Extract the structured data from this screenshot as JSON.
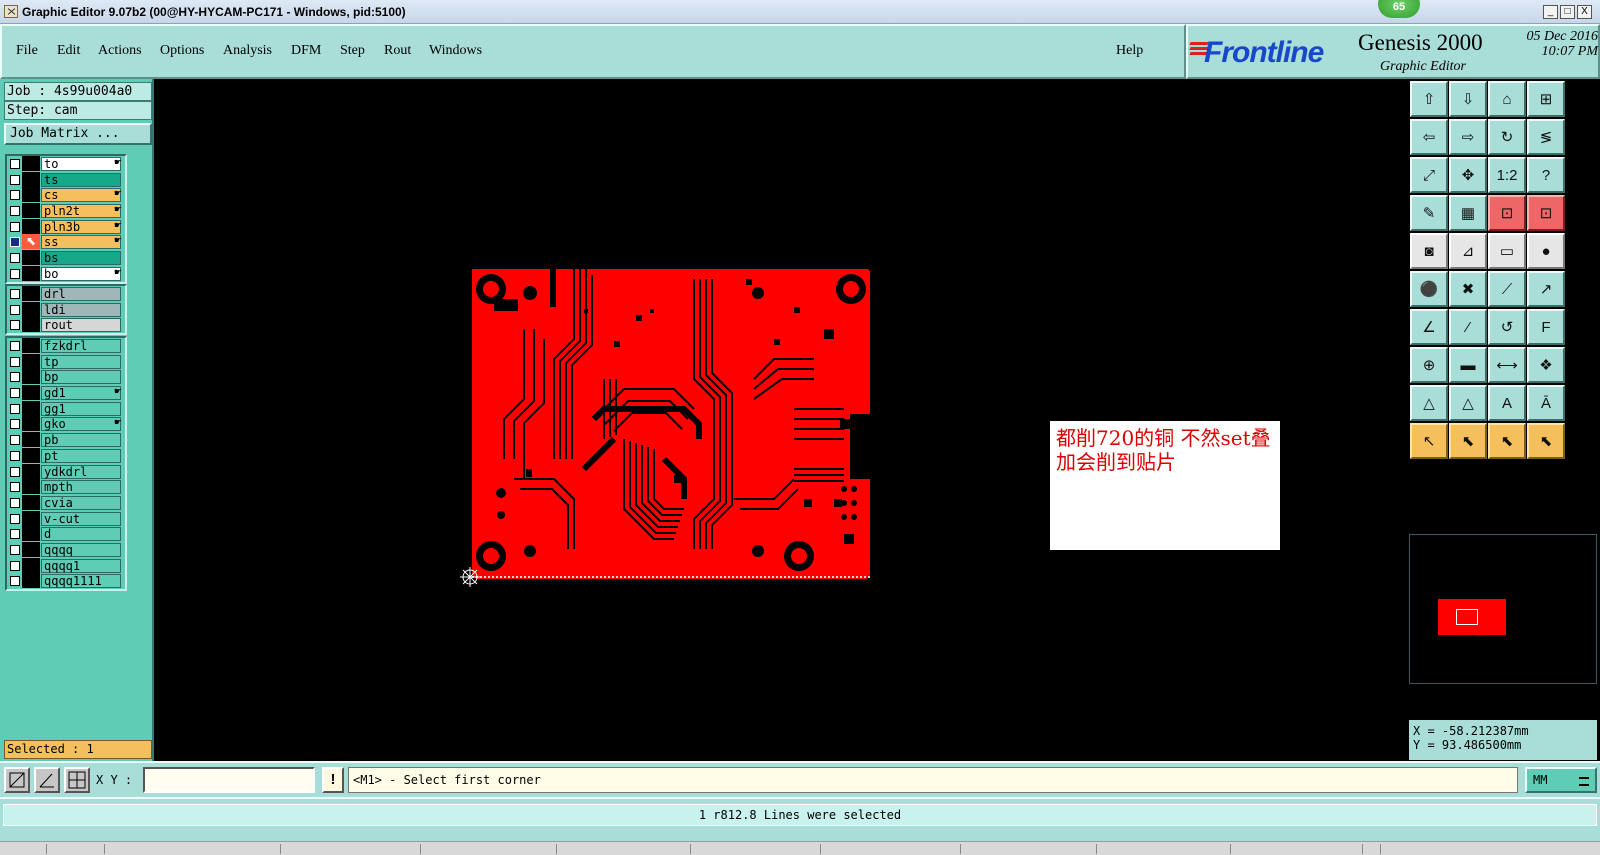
{
  "window": {
    "title": "Graphic Editor 9.07b2 (00@HY-HYCAM-PC171 - Windows, pid:5100)",
    "badge": "65",
    "controls": [
      "_",
      "□",
      "X"
    ]
  },
  "menu": {
    "items": [
      "File",
      "Edit",
      "Actions",
      "Options",
      "Analysis",
      "DFM",
      "Step",
      "Rout",
      "Windows"
    ],
    "help": "Help"
  },
  "branding": {
    "logo": "Frontline",
    "product": "Genesis 2000",
    "subtitle": "Graphic Editor",
    "date": "05 Dec 2016",
    "time": "10:07 PM"
  },
  "job": {
    "job_label": "Job : 4s99u004a0",
    "step_label": "Step: cam",
    "matrix_button": "Job Matrix ..."
  },
  "layers": {
    "group1": [
      {
        "name": "to",
        "color": "#ffffff",
        "hand": true
      },
      {
        "name": "ts",
        "color": "#17a88a",
        "hand": false
      },
      {
        "name": "cs",
        "color": "#f5bf5b",
        "hand": true
      },
      {
        "name": "pln2t",
        "color": "#f5bf5b",
        "hand": true
      },
      {
        "name": "pln3b",
        "color": "#f5bf5b",
        "hand": true
      },
      {
        "name": "ss",
        "color": "#f5bf5b",
        "hand": true,
        "active": true
      },
      {
        "name": "bs",
        "color": "#17a88a",
        "hand": false
      },
      {
        "name": "bo",
        "color": "#ffffff",
        "hand": true
      }
    ],
    "group2": [
      {
        "name": "drl",
        "color": "#9fb7b8",
        "hand": false
      },
      {
        "name": "ldi",
        "color": "#9fb7b8",
        "hand": false
      },
      {
        "name": "rout",
        "color": "#d6d6d6",
        "hand": false
      }
    ],
    "group3": [
      {
        "name": "fzkdrl",
        "color": "#5fcdb5",
        "hand": false
      },
      {
        "name": "tp",
        "color": "#5fcdb5",
        "hand": false
      },
      {
        "name": "bp",
        "color": "#5fcdb5",
        "hand": false
      },
      {
        "name": "gd1",
        "color": "#5fcdb5",
        "hand": true
      },
      {
        "name": "gg1",
        "color": "#5fcdb5",
        "hand": false
      },
      {
        "name": "gko",
        "color": "#5fcdb5",
        "hand": true
      },
      {
        "name": "pb",
        "color": "#5fcdb5",
        "hand": false
      },
      {
        "name": "pt",
        "color": "#5fcdb5",
        "hand": false
      },
      {
        "name": "ydkdrl",
        "color": "#5fcdb5",
        "hand": false
      },
      {
        "name": "mpth",
        "color": "#5fcdb5",
        "hand": false
      },
      {
        "name": "cvia",
        "color": "#5fcdb5",
        "hand": false
      },
      {
        "name": "v-cut",
        "color": "#5fcdb5",
        "hand": false
      },
      {
        "name": "d",
        "color": "#5fcdb5",
        "hand": false
      },
      {
        "name": "qqqq",
        "color": "#5fcdb5",
        "hand": false
      },
      {
        "name": "qqqq1",
        "color": "#5fcdb5",
        "hand": false
      },
      {
        "name": "qqqq1111",
        "color": "#5fcdb5",
        "hand": false
      }
    ]
  },
  "selected_label": "Selected : 1",
  "canvas": {
    "note_text": "都削720的铜  不然set叠加会削到贴片",
    "board_color": "#ff0000"
  },
  "toolbar": {
    "buttons": [
      {
        "icon": "zoom-home-icon",
        "glyph": "⇧",
        "style": "teal"
      },
      {
        "icon": "zoom-down-icon",
        "glyph": "⇩",
        "style": "teal"
      },
      {
        "icon": "home-view-icon",
        "glyph": "⌂",
        "style": "teal"
      },
      {
        "icon": "window-icon",
        "glyph": "⊞",
        "style": "teal"
      },
      {
        "icon": "pan-left-icon",
        "glyph": "⇦",
        "style": "teal"
      },
      {
        "icon": "pan-right-icon",
        "glyph": "⇨",
        "style": "teal"
      },
      {
        "icon": "redo-icon",
        "glyph": "↻",
        "style": "teal"
      },
      {
        "icon": "snap-icon",
        "glyph": "≶",
        "style": "teal"
      },
      {
        "icon": "fit-icon",
        "glyph": "⤢",
        "style": "teal"
      },
      {
        "icon": "center-icon",
        "glyph": "✥",
        "style": "teal"
      },
      {
        "icon": "one-to-two-icon",
        "glyph": "1:2",
        "style": "teal"
      },
      {
        "icon": "help-icon",
        "glyph": "?",
        "style": "teal"
      },
      {
        "icon": "graphic-control-icon",
        "glyph": "✎",
        "style": "teal"
      },
      {
        "icon": "grid-icon",
        "glyph": "▦",
        "style": "teal"
      },
      {
        "icon": "layer-display-icon",
        "glyph": "⊡",
        "style": "red"
      },
      {
        "icon": "layer-display2-icon",
        "glyph": "⊡",
        "style": "red"
      },
      {
        "icon": "features-icon",
        "glyph": "◙",
        "style": "lite"
      },
      {
        "icon": "measure-icon",
        "glyph": "⊿",
        "style": "lite"
      },
      {
        "icon": "ruler-icon",
        "glyph": "▭",
        "style": "lite"
      },
      {
        "icon": "pad-icon",
        "glyph": "●",
        "style": "lite"
      },
      {
        "icon": "connect-icon",
        "glyph": "⚫",
        "style": "teal"
      },
      {
        "icon": "cross-icon",
        "glyph": "✖",
        "style": "teal"
      },
      {
        "icon": "line-icon",
        "glyph": "⟋",
        "style": "teal"
      },
      {
        "icon": "arrow-line-icon",
        "glyph": "↗",
        "style": "teal"
      },
      {
        "icon": "angle-icon",
        "glyph": "∠",
        "style": "teal"
      },
      {
        "icon": "slope-icon",
        "glyph": "⁄",
        "style": "teal"
      },
      {
        "icon": "arc-icon",
        "glyph": "↺",
        "style": "teal"
      },
      {
        "icon": "text-icon",
        "glyph": "F",
        "style": "teal"
      },
      {
        "icon": "pad-move-icon",
        "glyph": "⊕",
        "style": "teal"
      },
      {
        "icon": "bar-icon",
        "glyph": "▬",
        "style": "teal"
      },
      {
        "icon": "span-icon",
        "glyph": "⟷",
        "style": "teal"
      },
      {
        "icon": "group-icon",
        "glyph": "❖",
        "style": "teal"
      },
      {
        "icon": "triangle-icon",
        "glyph": "△",
        "style": "teal"
      },
      {
        "icon": "triangle2-icon",
        "glyph": "△",
        "style": "teal"
      },
      {
        "icon": "letter-a-icon",
        "glyph": "A",
        "style": "teal"
      },
      {
        "icon": "letter-a2-icon",
        "glyph": "Ā",
        "style": "teal"
      },
      {
        "icon": "pointer-icon",
        "glyph": "↖",
        "style": "orange"
      },
      {
        "icon": "pointer-box-icon",
        "glyph": "⬉",
        "style": "orange"
      },
      {
        "icon": "pointer-circle-icon",
        "glyph": "⬉",
        "style": "orange"
      },
      {
        "icon": "pointer-node-icon",
        "glyph": "⬉",
        "style": "orange"
      }
    ]
  },
  "coords": {
    "x": "X = -58.212387mm",
    "y": "Y = 93.486500mm"
  },
  "command": {
    "xy_label": "X Y :",
    "xy_value": "",
    "exclaim": "!",
    "prompt": "<M1> - Select first corner",
    "units": "MM"
  },
  "status": {
    "message": "1 r812.8 Lines were selected"
  }
}
